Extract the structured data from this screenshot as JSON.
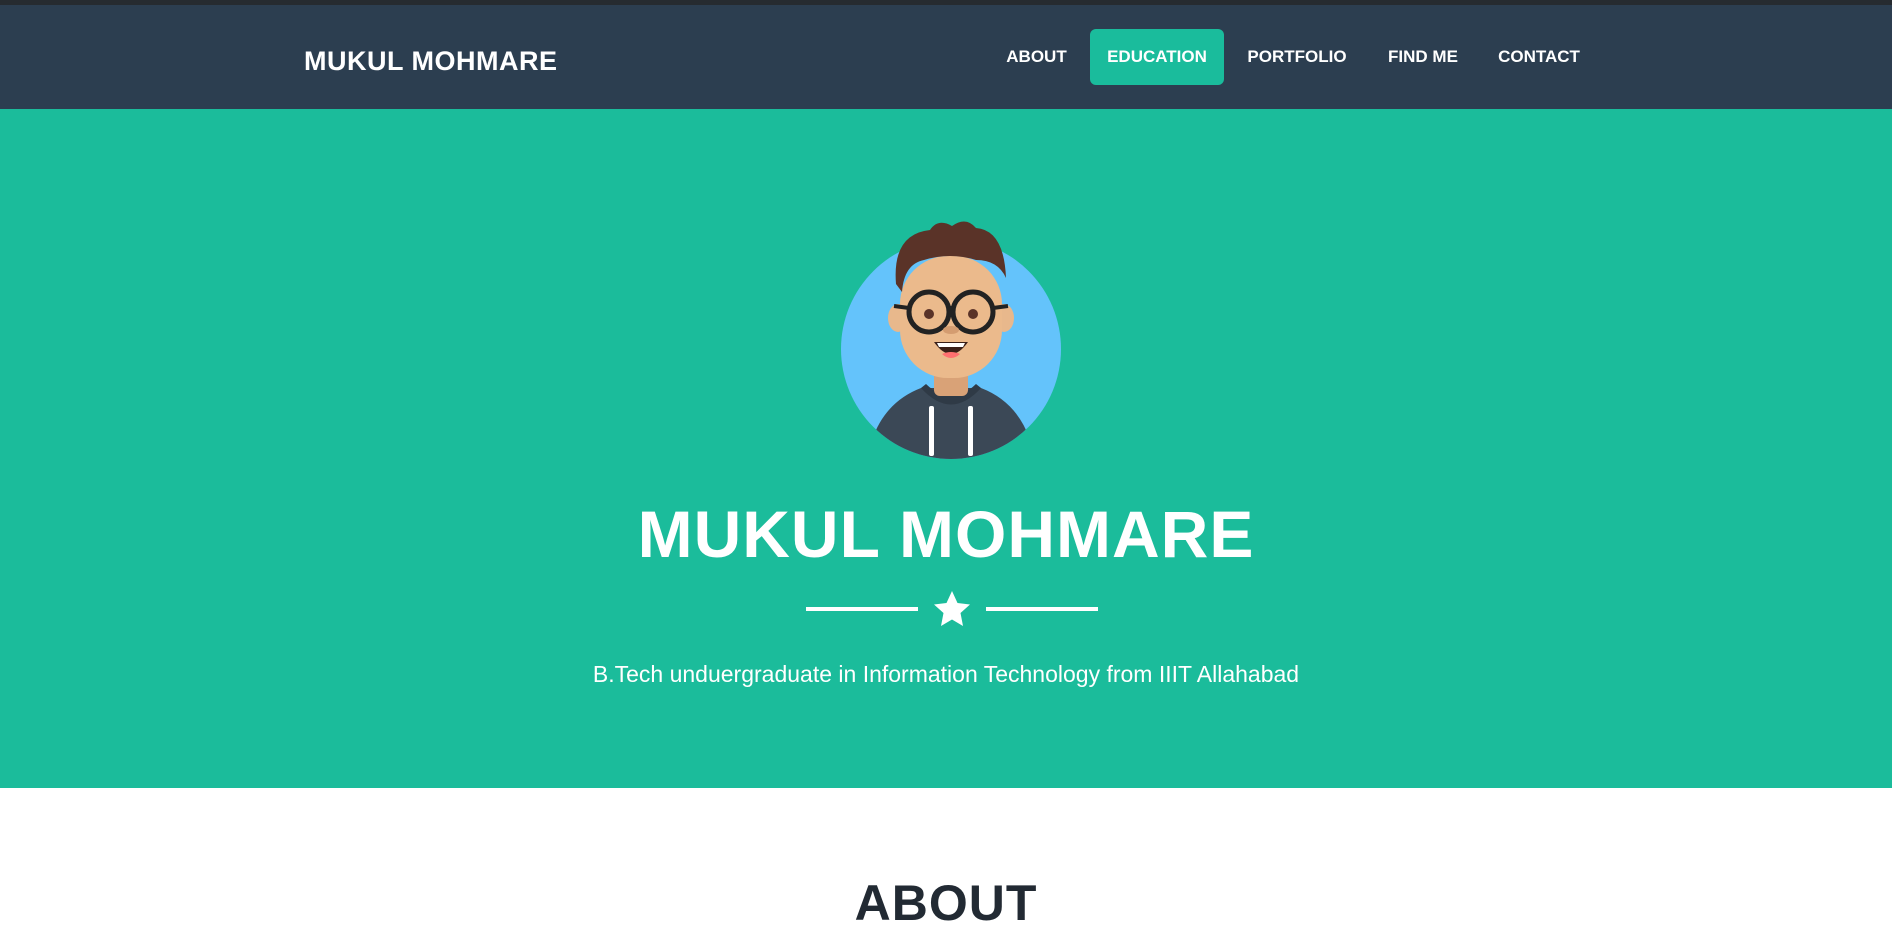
{
  "nav": {
    "brand": "MUKUL MOHMARE",
    "items": [
      {
        "label": "ABOUT",
        "active": false
      },
      {
        "label": "EDUCATION",
        "active": true
      },
      {
        "label": "PORTFOLIO",
        "active": false
      },
      {
        "label": "FIND ME",
        "active": false
      },
      {
        "label": "CONTACT",
        "active": false
      }
    ]
  },
  "hero": {
    "avatar_icon": "avatar-illustration",
    "title": "MUKUL MOHMARE",
    "divider_icon": "star-icon",
    "subtitle": "B.Tech unduergraduate in Information Technology from IIIT Allahabad"
  },
  "about": {
    "title": "ABOUT"
  },
  "colors": {
    "navbar": "#2c3e50",
    "accent": "#1abc9c",
    "text_light": "#ffffff",
    "heading_dark": "#222a33"
  }
}
